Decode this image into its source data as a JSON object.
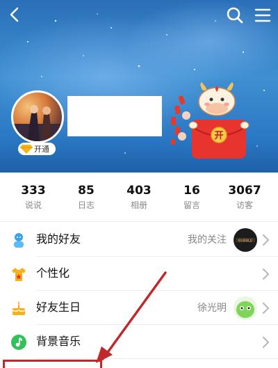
{
  "header": {
    "mascot_sign": "开"
  },
  "profile": {
    "vip_label": "开通"
  },
  "stats": [
    {
      "value": "333",
      "label": "说说"
    },
    {
      "value": "85",
      "label": "日志"
    },
    {
      "value": "403",
      "label": "相册"
    },
    {
      "value": "16",
      "label": "留言"
    },
    {
      "value": "3067",
      "label": "访客"
    }
  ],
  "menu": {
    "friends": {
      "title": "我的好友",
      "right": "我的关注",
      "thumb_text": "BUBBLE"
    },
    "personalize": {
      "title": "个性化"
    },
    "birthday": {
      "title": "好友生日",
      "right": "徐光明"
    },
    "music": {
      "title": "背景音乐"
    }
  },
  "colors": {
    "header_blue": "#3f8fd2",
    "annotation_red": "#c0282b",
    "hongbao_red": "#e8342f"
  }
}
